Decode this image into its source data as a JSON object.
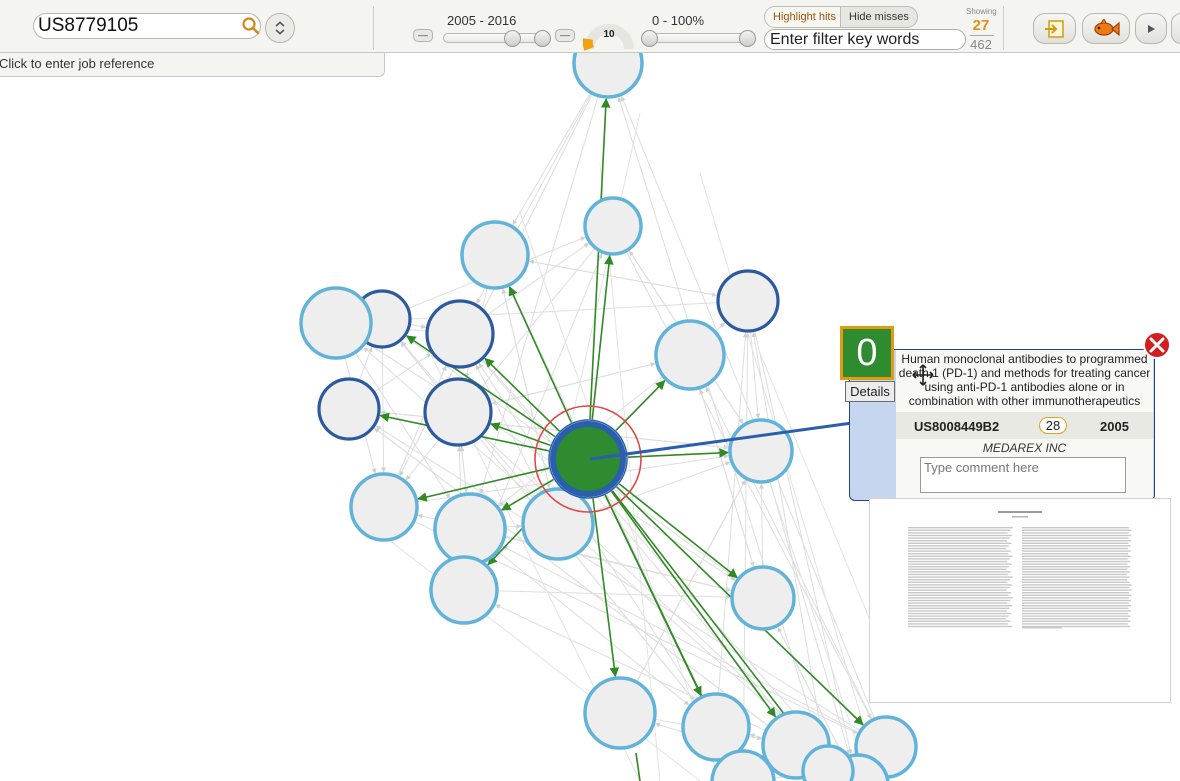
{
  "toolbar": {
    "search_value": "US8779105",
    "year_range": "2005 - 2016",
    "relevance_range": "0 - 100%",
    "gauge_value": "10",
    "mini_button_label": "––",
    "highlight_hits_label": "Highlight hits",
    "hide_misses_label": "Hide misses",
    "filter_placeholder": "Enter filter key words",
    "showing_label": "Showing",
    "showing_count": "27",
    "total_count": "462",
    "year_slider": {
      "min": 2005,
      "max": 2016
    },
    "relevance_slider": {
      "min_percent": 0,
      "max_percent": 100
    }
  },
  "job_reference": {
    "prompt": "Click to enter job reference"
  },
  "popup": {
    "score": "0",
    "details_label": "Details",
    "title": "Human monoclonal antibodies to programmed death 1 (PD-1) and methods for treating cancer using anti-PD-1 antibodies alone or in combination with other immunotherapeutics",
    "patent_number": "US8008449B2",
    "citation_count": "28",
    "year": "2005",
    "assignee": "MEDAREX INC",
    "comment_placeholder": "Type comment here"
  },
  "colors": {
    "focus_node": "#2e8b30",
    "focus_ring": "#2a5fad",
    "light_node_border": "#62b3d9",
    "dark_node_border": "#2c5a9e",
    "node_fill": "#eeeeee",
    "citation_arrow": "#2f8a24",
    "accent_orange": "#e4901a"
  },
  "icons": [
    "search-icon",
    "chevron-up-down-icon",
    "gauge-icon",
    "export-icon",
    "fish-icon",
    "play-icon",
    "close-icon",
    "move-cursor-icon"
  ]
}
